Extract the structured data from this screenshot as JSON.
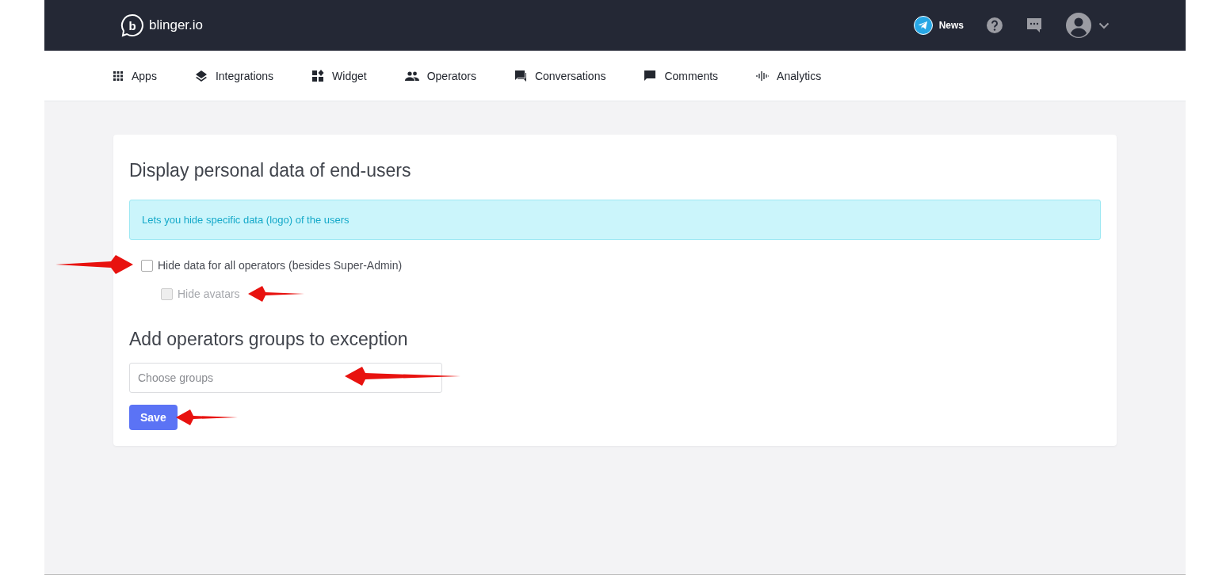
{
  "brand": {
    "logo_letter": "b",
    "name": "blinger.io"
  },
  "header": {
    "news": "News"
  },
  "nav": [
    {
      "label": "Apps"
    },
    {
      "label": "Integrations"
    },
    {
      "label": "Widget"
    },
    {
      "label": "Operators"
    },
    {
      "label": "Conversations"
    },
    {
      "label": "Comments"
    },
    {
      "label": "Analytics"
    }
  ],
  "card": {
    "title": "Display personal data of end-users",
    "info": "Lets you hide specific data (logo) of the users",
    "options": [
      {
        "label": "Hide data for all operators (besides Super-Admin)",
        "checked": false,
        "disabled": false,
        "children": [
          {
            "label": "Hide avatars",
            "checked": false,
            "disabled": true
          }
        ]
      }
    ],
    "section_title": "Add operators groups to exception",
    "groups_field": {
      "placeholder": "Choose groups"
    },
    "save_button": "Save"
  }
}
